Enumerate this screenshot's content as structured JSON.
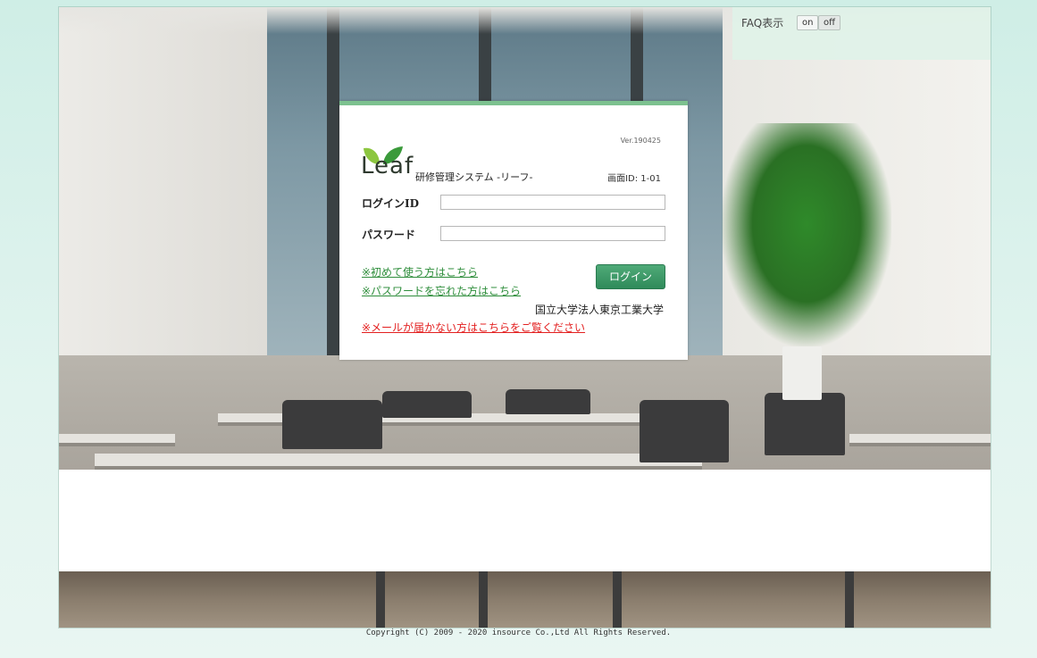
{
  "faq": {
    "label": "FAQ表示",
    "on_label": "on",
    "off_label": "off"
  },
  "login": {
    "version": "Ver.190425",
    "logo_text": "Leaf",
    "system_name": "研修管理システム -リーフ-",
    "screen_id": "画面ID: 1-01",
    "login_id_label": "ログインID",
    "password_label": "パスワード",
    "login_id_value": "",
    "password_value": "",
    "first_time_link": "※初めて使う方はこちら",
    "forgot_password_link": "※パスワードを忘れた方はこちら",
    "login_button": "ログイン",
    "university": "国立大学法人東京工業大学",
    "mail_issue_link": "※メールが届かない方はこちらをご覧ください"
  },
  "footer": {
    "copyright": "Copyright (C) 2009 - 2020 insource Co.,Ltd All Rights Reserved."
  },
  "colors": {
    "accent": "#7cc18f",
    "button": "#2f8a5a",
    "link": "#2f8e3c",
    "warning_link": "#e32020"
  }
}
